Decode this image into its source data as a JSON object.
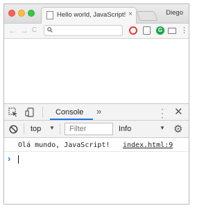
{
  "window": {
    "tab_title": "Hello world, JavaScript!",
    "tab_close": "×",
    "profile_name": "Diego"
  },
  "toolbar": {
    "back": "←",
    "forward": "→",
    "reload": "C",
    "extension_g": "G",
    "menu": "⋮"
  },
  "devtools": {
    "console_tab_label": "Console",
    "more_tabs": "»",
    "context": "top",
    "context_caret": "▼",
    "filter_placeholder": "Filter",
    "log_level": "Info",
    "log_level_caret": "▼",
    "close": "✕",
    "settings": "⚙",
    "logs": [
      {
        "message": "Olá mundo, JavaScript!",
        "source": "index.html:9"
      }
    ],
    "prompt": "›"
  },
  "colors": {
    "accent": "#1a73e8",
    "traffic_close": "#fc605b",
    "traffic_min": "#fdbc40",
    "traffic_max": "#34c84a"
  }
}
